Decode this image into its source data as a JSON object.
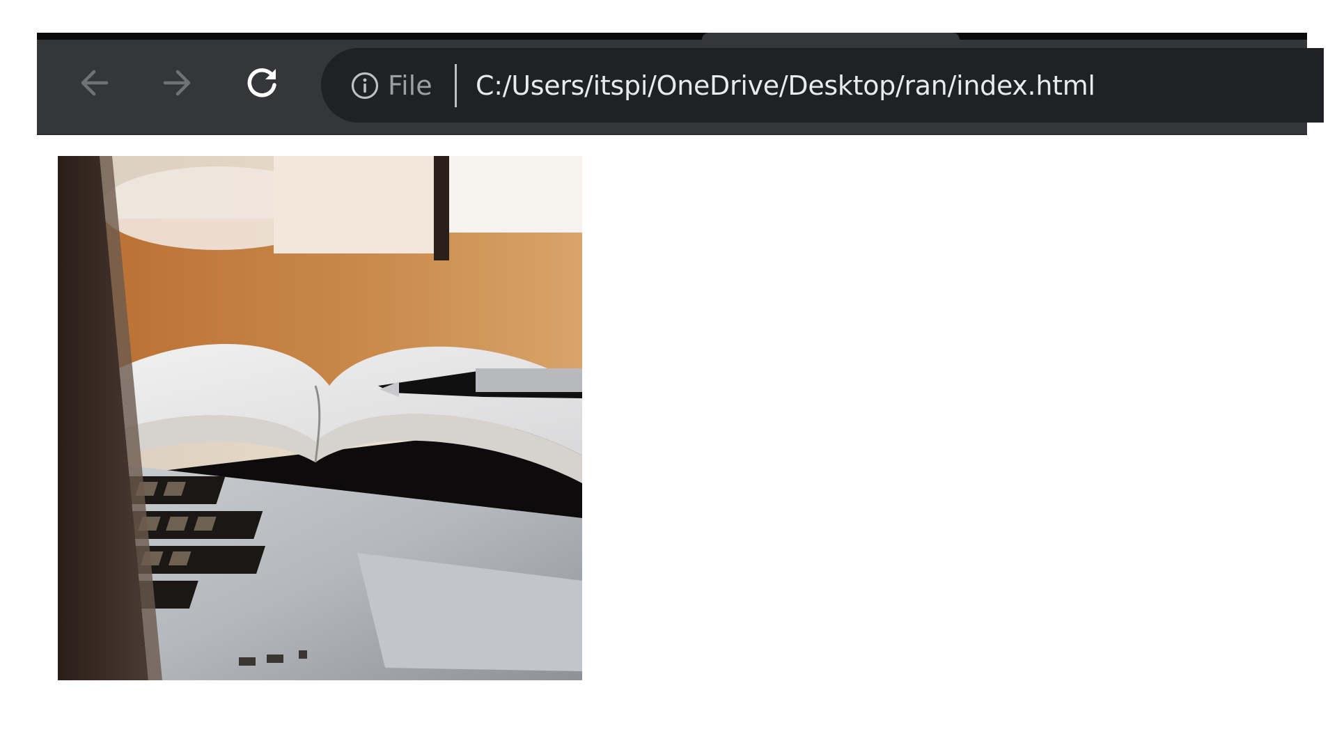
{
  "browser": {
    "address_bar": {
      "security_chip_icon": "info-icon",
      "scheme_label": "File",
      "url": "C:/Users/itspi/OneDrive/Desktop/ran/index.html"
    },
    "toolbar": {
      "back_icon": "arrow-left-icon",
      "forward_icon": "arrow-right-icon",
      "reload_icon": "reload-icon"
    },
    "colors": {
      "toolbar": "#35363a",
      "omnibox": "#202124",
      "tab_strip": "#0b0b0c",
      "url_text": "#e8eaed",
      "scheme_text": "#9aa0a6"
    }
  },
  "page": {
    "image": {
      "subject": "laptop-notebook-pen-photo"
    }
  }
}
